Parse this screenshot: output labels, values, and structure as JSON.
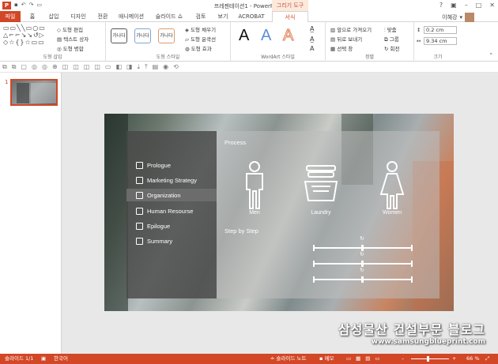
{
  "window": {
    "title": "프레젠테이션1 - PowerPoint",
    "context_label": "그리기 도구",
    "app_icon": "P"
  },
  "tabs": [
    {
      "label": "파일"
    },
    {
      "label": "홈"
    },
    {
      "label": "삽입"
    },
    {
      "label": "디자인"
    },
    {
      "label": "전환"
    },
    {
      "label": "애니메이션"
    },
    {
      "label": "슬라이드 쇼"
    },
    {
      "label": "검토"
    },
    {
      "label": "보기"
    },
    {
      "label": "ACROBAT"
    },
    {
      "label": "서식"
    }
  ],
  "user": {
    "name": "이혜강"
  },
  "ribbon": {
    "insert_shapes": {
      "label": "도형 삽입",
      "edit_shape": "도형 편집",
      "text_box": "텍스트 상자",
      "merge_shapes": "도형 병합"
    },
    "shape_styles": {
      "label": "도형 스타일",
      "swatches": [
        "가나다",
        "가나다",
        "가나다"
      ],
      "fill": "도형 채우기",
      "outline": "도형 윤곽선",
      "effects": "도형 효과"
    },
    "wordart": {
      "label": "WordArt 스타일",
      "letters": [
        "A",
        "A",
        "A"
      ]
    },
    "arrange": {
      "label": "정렬",
      "bring_forward": "앞으로 가져오기",
      "send_backward": "뒤로 보내기",
      "selection_pane": "선택 창",
      "align": "맞춤",
      "group": "그룹",
      "rotate": "회전"
    },
    "size": {
      "label": "크기",
      "height": "0.2 cm",
      "width": "9.34 cm"
    }
  },
  "thumbnail": {
    "number": "1"
  },
  "slide": {
    "menu": [
      {
        "label": "Prologue"
      },
      {
        "label": "Marketing Strategy"
      },
      {
        "label": "Organization"
      },
      {
        "label": "Human Resourse"
      },
      {
        "label": "Epilogue"
      },
      {
        "label": "Summary"
      }
    ],
    "process_title": "Process",
    "icons": [
      {
        "label": "Men"
      },
      {
        "label": "Laundry"
      },
      {
        "label": "Women"
      }
    ],
    "steps_title": "Step by Step"
  },
  "watermark": {
    "line1": "삼성물산 건설부문 블로그",
    "line2": "www.samsungblueprint.com"
  },
  "status": {
    "slide": "슬라이드 1/1",
    "language": "한국어",
    "notes": "슬라이드 노트",
    "comments": "메모",
    "zoom": "66 %"
  }
}
